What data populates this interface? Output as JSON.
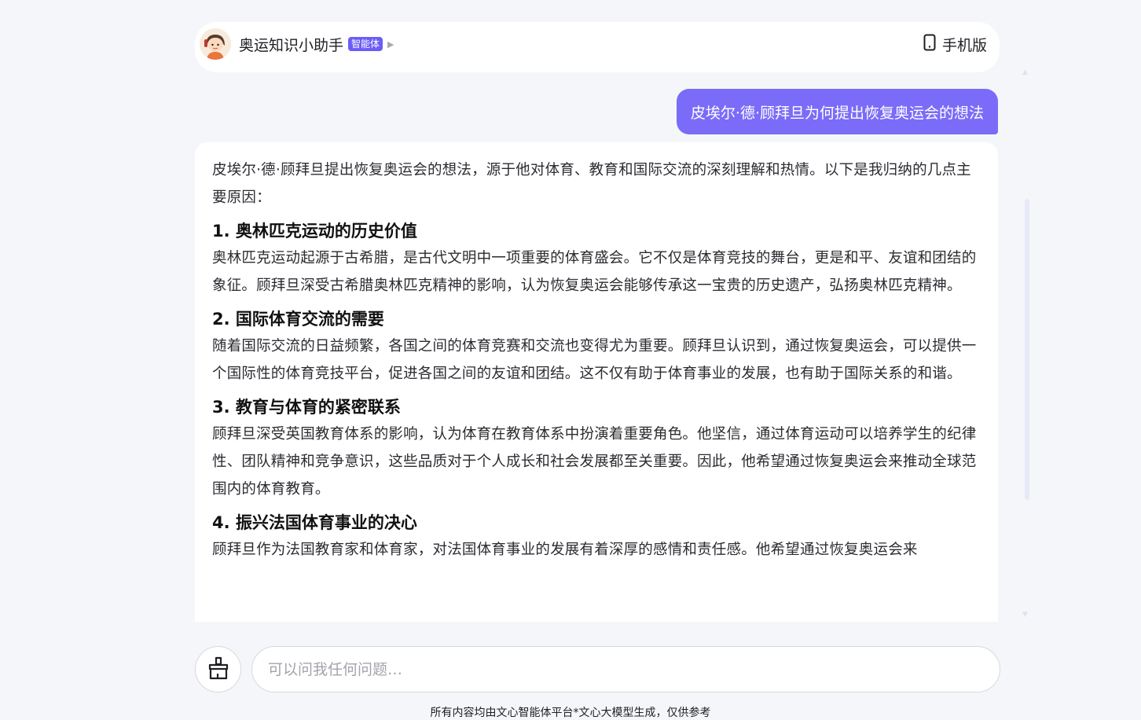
{
  "header": {
    "agent_name": "奥运知识小助手",
    "agent_badge": "智能体",
    "mobile_label": "手机版"
  },
  "conversation": {
    "user_message": "皮埃尔·德·顾拜旦为何提出恢复奥运会的想法",
    "answer": {
      "intro": "皮埃尔·德·顾拜旦提出恢复奥运会的想法，源于他对体育、教育和国际交流的深刻理解和热情。以下是我归纳的几点主要原因：",
      "sections": [
        {
          "title": "1. 奥林匹克运动的历史价值",
          "body": "奥林匹克运动起源于古希腊，是古代文明中一项重要的体育盛会。它不仅是体育竞技的舞台，更是和平、友谊和团结的象征。顾拜旦深受古希腊奥林匹克精神的影响，认为恢复奥运会能够传承这一宝贵的历史遗产，弘扬奥林匹克精神。"
        },
        {
          "title": "2. 国际体育交流的需要",
          "body": "随着国际交流的日益频繁，各国之间的体育竞赛和交流也变得尤为重要。顾拜旦认识到，通过恢复奥运会，可以提供一个国际性的体育竞技平台，促进各国之间的友谊和团结。这不仅有助于体育事业的发展，也有助于国际关系的和谐。"
        },
        {
          "title": "3. 教育与体育的紧密联系",
          "body": "顾拜旦深受英国教育体系的影响，认为体育在教育体系中扮演着重要角色。他坚信，通过体育运动可以培养学生的纪律性、团队精神和竞争意识，这些品质对于个人成长和社会发展都至关重要。因此，他希望通过恢复奥运会来推动全球范围内的体育教育。"
        },
        {
          "title": "4. 振兴法国体育事业的决心",
          "body": "顾拜旦作为法国教育家和体育家，对法国体育事业的发展有着深厚的感情和责任感。他希望通过恢复奥运会来"
        }
      ]
    }
  },
  "composer": {
    "placeholder": "可以问我任何问题…"
  },
  "footer": {
    "disclaimer": "所有内容均由文心智能体平台*文心大模型生成，仅供参考"
  },
  "colors": {
    "accent": "#7a6cf8",
    "badge": "#6b5cf6",
    "background": "#f5f6fa"
  },
  "icons": {
    "mobile": "phone-icon",
    "tool": "broom-icon",
    "chevron": "chevron-right-icon"
  }
}
